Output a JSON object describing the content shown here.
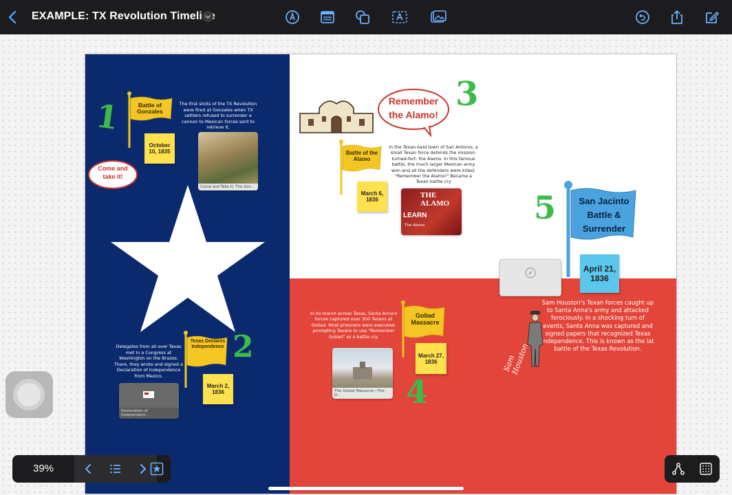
{
  "toolbar": {
    "title": "EXAMPLE: TX Revolution Timeline",
    "icons": [
      "back-icon",
      "title-menu-chevron-icon",
      "pen-tool-icon",
      "note-tool-icon",
      "shape-tool-icon",
      "text-tool-icon",
      "image-tool-icon",
      "undo-icon",
      "share-icon",
      "edit-icon"
    ]
  },
  "board": {
    "gonzales": {
      "number": "1",
      "flag": "Battle of Gonzales",
      "date": "October 10, 1835",
      "bubble": "Come and take it!",
      "description": "The first shots of the TX Revolution were fired at Gonzales when TX settlers refused to surrender a cannon to Mexican forces sent to retrieve it.",
      "thumb_caption": "Come and Take It: The Gon..."
    },
    "declaration": {
      "number": "2",
      "flag": "Texas Declares Independence",
      "date": "March 2, 1836",
      "description": "Delegates from all over Texas met in a Congress at Washington on the Brazos. There, they wrote and signed a Declaration of Independence from Mexico.",
      "thumb_caption": "Declaration of Independenc..."
    },
    "alamo": {
      "number": "3",
      "bubble": "Remember the Alamo!",
      "flag": "Battle of the Alamo",
      "date": "March 6, 1836",
      "description": "In the Texan-held town of San Antonio, a small Texan force defends the mission-turned-fort: the Alamo. In this famous battle, the much larger Mexican army won and all the defenders were killed. \"Remember the Alamo!\" Became a Texan battle cry",
      "thumb_title": "THE ALAMO",
      "thumb_learn": "LEARN",
      "thumb_caption": "The Alamo"
    },
    "goliad": {
      "number": "4",
      "flag": "Goliad Massacre",
      "date": "March 27, 1836",
      "description": "In its march across Texas, Santa Anna's forces captured over 300 Texans at Goliad. Most prisoners were executed, prompting Texans to use \"Remember Goliad\" as a battle cry.",
      "thumb_caption": "The Goliad Massacre—The G..."
    },
    "san_jacinto": {
      "number": "5",
      "flag": "San Jacinto Battle & Surrender",
      "date": "April 21, 1836",
      "description": "Sam Houston's Texan forces caught up to Santa Anna's army and attacked ferociously. In a shocking turn of events, Santa Anna was captured and signed papers that recognized Texas Independence. This is known as the lat battle of the Texas Revolution.",
      "signature": "Sam Houston"
    }
  },
  "bottom": {
    "zoom": "39%"
  },
  "colors": {
    "blue": "#0b2a6e",
    "red": "#e3453a",
    "sticky": "#ffe14d",
    "green": "#3dbb4a"
  }
}
